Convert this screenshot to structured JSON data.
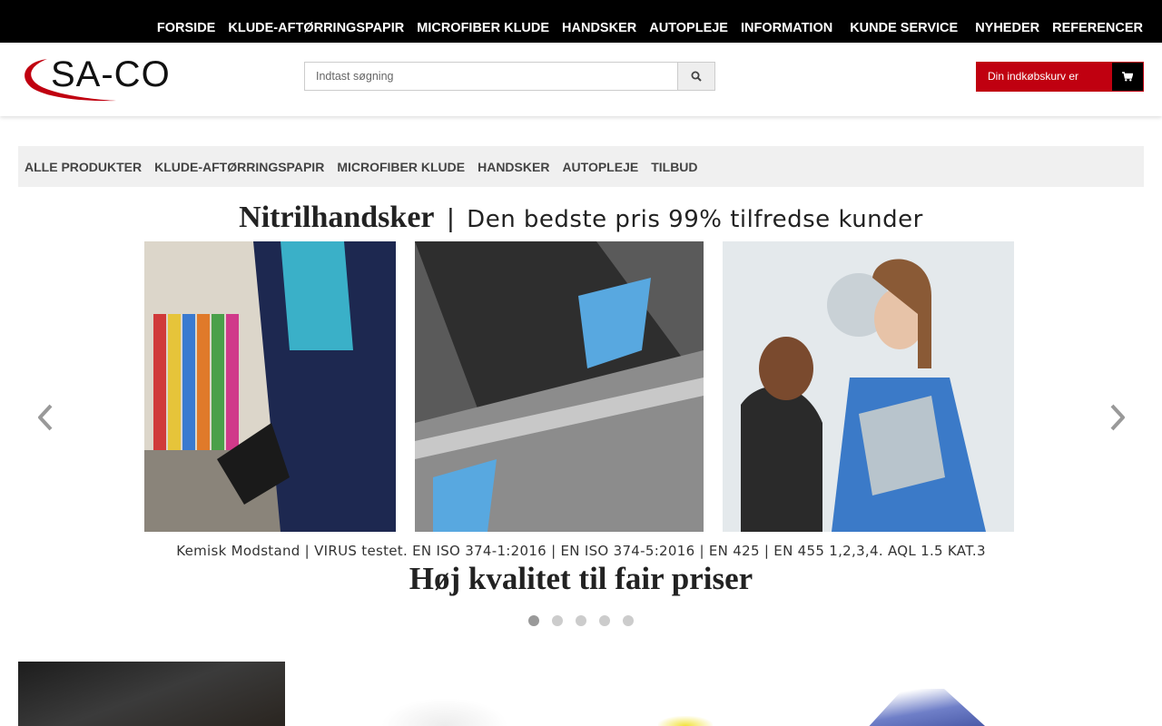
{
  "topnav": {
    "items": [
      "FORSIDE",
      "KLUDE-AFTØRRINGSPAPIR",
      "MICROFIBER KLUDE",
      "HANDSKER",
      "AUTOPLEJE",
      "INFORMATION",
      "KUNDE SERVICE",
      "NYHEDER",
      "REFERENCER"
    ]
  },
  "header": {
    "logo_text": "SA-CO",
    "search_placeholder": "Indtast søgning",
    "cart_label": "Din indkøbskurv er tom"
  },
  "catbar": {
    "items": [
      "ALLE PRODUKTER",
      "KLUDE-AFTØRRINGSPAPIR",
      "MICROFIBER KLUDE",
      "HANDSKER",
      "AUTOPLEJE",
      "TILBUD"
    ]
  },
  "slider": {
    "title_bold": "Nitrilhandsker",
    "title_sep": "|",
    "title_rest": "Den bedste pris 99% tilfredse kunder",
    "caption": "Kemisk Modstand | VIRUS testet. EN ISO 374-1:2016 | EN ISO 374-5:2016 | EN 425 | EN 455 1,2,3,4. AQL 1.5 KAT.3",
    "tagline": "Høj kvalitet til fair priser",
    "slide_count": 5,
    "active_slide": 1
  },
  "colors": {
    "topbar": "#000000",
    "cart": "#c00010",
    "catbar": "#f0f0f0"
  },
  "icons": {
    "search": "search-icon",
    "cart": "cart-icon",
    "prev": "chevron-left-icon",
    "next": "chevron-right-icon"
  }
}
